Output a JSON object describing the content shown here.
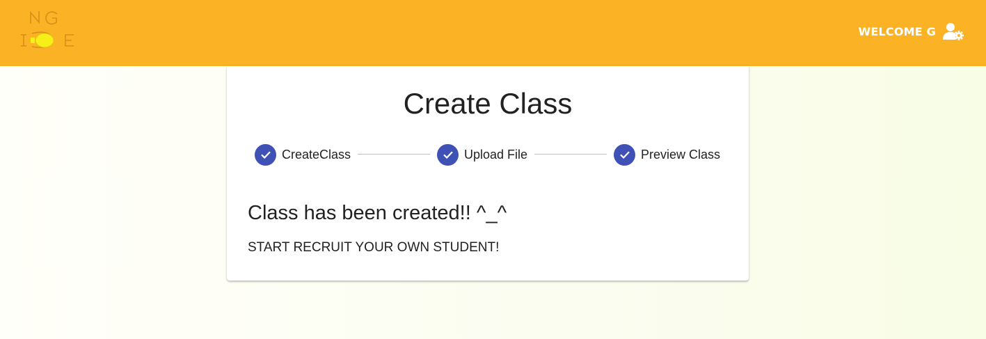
{
  "header": {
    "logo_text": "NG IDE",
    "welcome_text": "WELCOME G",
    "user_icon": "user-settings-icon"
  },
  "card": {
    "title": "Create Class",
    "steps": [
      {
        "label": "CreateClass",
        "status": "completed",
        "icon": "check-icon"
      },
      {
        "label": "Upload File",
        "status": "completed",
        "icon": "check-icon"
      },
      {
        "label": "Preview Class",
        "status": "completed",
        "icon": "check-icon"
      }
    ],
    "message_title": "Class has been created!! ^_^",
    "message_subtitle": "START RECRUIT YOUR OWN STUDENT!"
  },
  "colors": {
    "topbar": "#fbb225",
    "step_complete": "#3f51b5",
    "text": "#212121"
  }
}
